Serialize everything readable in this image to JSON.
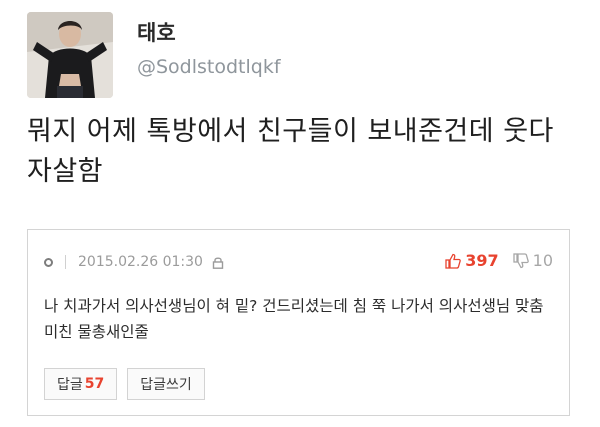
{
  "tweet": {
    "display_name": "태호",
    "handle": "@Sodlstodtlqkf",
    "text": "뭐지 어제 톡방에서 친구들이 보내준건데 웃다 자살함"
  },
  "comment": {
    "date": "2015.02.26 01:30",
    "upvotes": "397",
    "downvotes": "10",
    "body": "나 치과가서 의사선생님이 혀 밑? 건드리셨는데 침 쭉 나가서 의사선생님 맞춤 미친 물총새인줄",
    "reply_label": "답글",
    "reply_count": "57",
    "write_reply_label": "답글쓰기"
  },
  "icons": {
    "avatar": "profile-photo",
    "status": "circle-icon",
    "lock": "lock-icon",
    "upvote": "thumbs-up-icon",
    "downvote": "thumbs-down-icon"
  },
  "colors": {
    "upvote_accent": "#e8432f",
    "handle": "#8f969c",
    "card_border": "#d4d4d4"
  }
}
